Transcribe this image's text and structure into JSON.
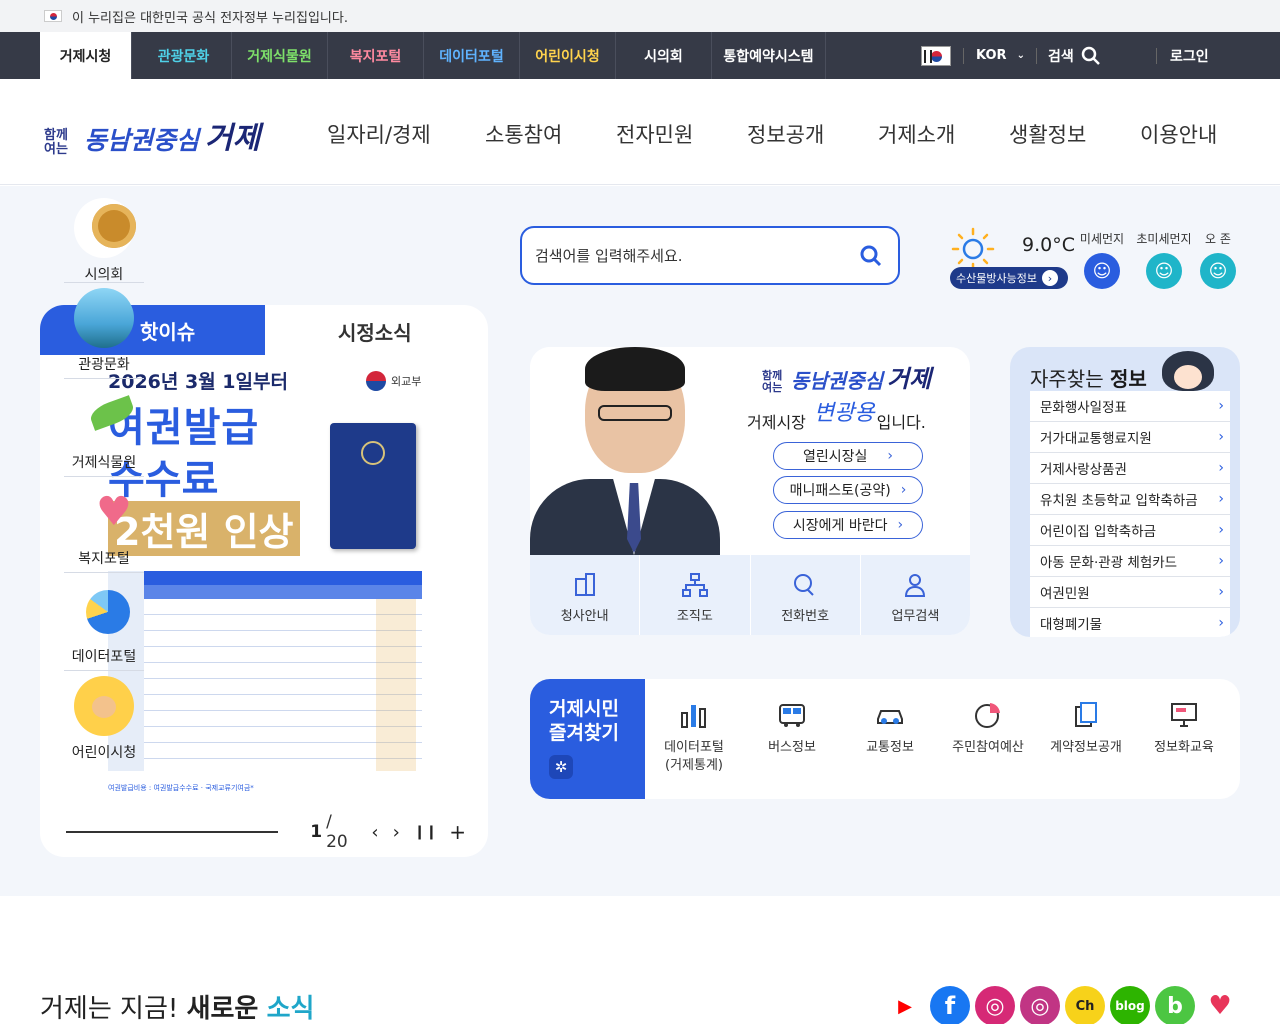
{
  "gov_banner": {
    "text": "이 누리집은 대한민국 공식 전자정부 누리집입니다."
  },
  "top_nav": {
    "tabs": [
      {
        "label": "거제시청",
        "color": "#222222"
      },
      {
        "label": "관광문화",
        "color": "#4fd1e8"
      },
      {
        "label": "거제식물원",
        "color": "#7ee06a"
      },
      {
        "label": "복지포털",
        "color": "#ff8aa0"
      },
      {
        "label": "데이터포털",
        "color": "#5fb3ff"
      },
      {
        "label": "어린이시청",
        "color": "#ffd34d"
      },
      {
        "label": "시의회",
        "color": "#ffffff"
      },
      {
        "label": "통합예약시스템",
        "color": "#ffffff"
      }
    ],
    "language": "KOR",
    "search_label": "검색",
    "login_label": "로그인"
  },
  "header": {
    "logo": {
      "small": "함께 여는",
      "mid": "동남권중심",
      "big": "거제"
    },
    "menu": [
      "일자리/경제",
      "소통참여",
      "전자민원",
      "정보공개",
      "거제소개",
      "생활정보",
      "이용안내"
    ]
  },
  "quick_links": [
    "시의회",
    "관광문화",
    "거제식물원",
    "복지포털",
    "데이터포털",
    "어린이시청"
  ],
  "news": {
    "tab_active": "핫이슈",
    "tab_other": "시정소식",
    "poster": {
      "date": "2026년 3월 1일부터",
      "line1": "여권발급",
      "line2": "수수료",
      "line3": "2천원 인상",
      "org": "외교부",
      "footnote": "여권발급비용 : 여권발급수수료 · 국제교류기여금*"
    },
    "pager": {
      "current": "1",
      "total": "/ 20"
    }
  },
  "search": {
    "placeholder": "검색어를 입력해주세요."
  },
  "weather": {
    "temp": "9.0°C",
    "sub_button": "수산물방사능정보",
    "dust": [
      {
        "label": "미세먼지",
        "color": "#2a5ddf"
      },
      {
        "label": "초미세먼지",
        "color": "#1fb5c9"
      },
      {
        "label": "오 존",
        "color": "#1fb5c9"
      }
    ]
  },
  "mayor": {
    "slogan_small": "함께 여는",
    "slogan_mid": "동남권중심",
    "slogan_big": "거제",
    "title_prefix": "거제시장",
    "name": "변광용",
    "title_suffix": "입니다.",
    "links": [
      "열린시장실",
      "매니패스토(공약)",
      "시장에게 바란다"
    ],
    "menu": [
      "청사안내",
      "조직도",
      "전화번호",
      "업무검색"
    ]
  },
  "frequent": {
    "title_prefix": "자주찾는",
    "title_bold": "정보",
    "items": [
      "문화행사일정표",
      "거가대교통행료지원",
      "거제사랑상품권",
      "유치원 초등학교 입학축하금",
      "어린이집 입학축하금",
      "아동 문화·관광 체험카드",
      "여권민원",
      "대형폐기물"
    ]
  },
  "enjoy": {
    "title1": "거제시민",
    "title2": "즐겨찾기",
    "items": [
      {
        "label": "데이터포털",
        "sub": "(거제통계)"
      },
      {
        "label": "버스정보",
        "sub": ""
      },
      {
        "label": "교통정보",
        "sub": ""
      },
      {
        "label": "주민참여예산",
        "sub": ""
      },
      {
        "label": "계약정보공개",
        "sub": ""
      },
      {
        "label": "정보화교육",
        "sub": ""
      }
    ]
  },
  "now": {
    "prefix": "거제는 지금!",
    "bold1": "새로운",
    "bold2": "소식"
  },
  "sns": [
    {
      "icon": "youtube-icon",
      "text": "▶",
      "color": "#ff0000"
    },
    {
      "icon": "facebook-icon",
      "text": "f",
      "color": "#1877f2"
    },
    {
      "icon": "instagram-icon",
      "text": "◎",
      "color": "#d62976"
    },
    {
      "icon": "instagram-icon",
      "text": "◎",
      "color": "#c13584"
    },
    {
      "icon": "channel-icon",
      "text": "Ch",
      "color": "#f7d21a"
    },
    {
      "icon": "blog-icon",
      "text": "blog",
      "color": "#2db400"
    },
    {
      "icon": "band-icon",
      "text": "b",
      "color": "#4cc642"
    },
    {
      "icon": "heart-icon",
      "text": "♥",
      "color": "#ffffff"
    }
  ]
}
